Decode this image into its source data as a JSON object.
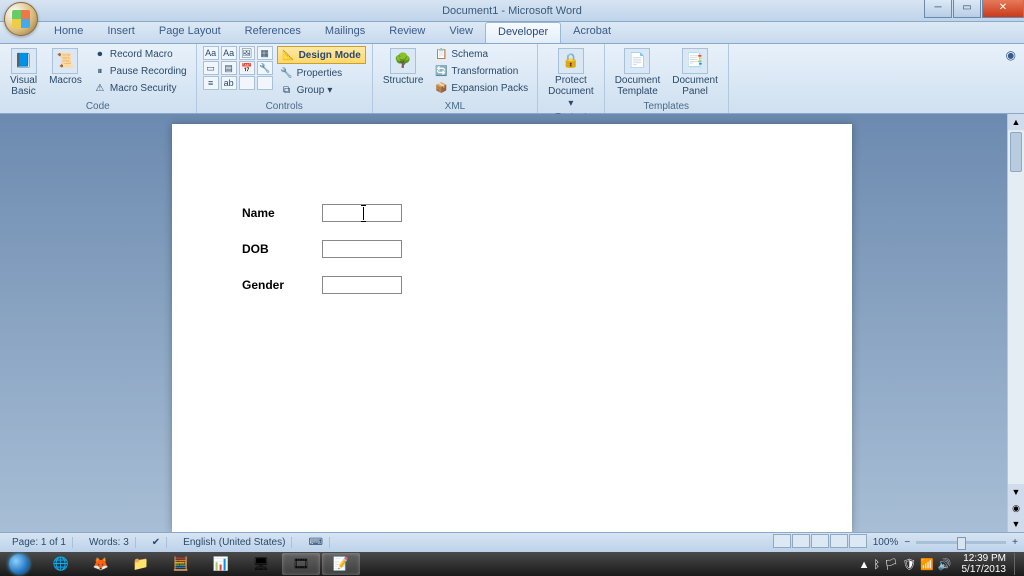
{
  "titlebar": {
    "title": "Document1 - Microsoft Word"
  },
  "tabs": [
    "Home",
    "Insert",
    "Page Layout",
    "References",
    "Mailings",
    "Review",
    "View",
    "Developer",
    "Acrobat"
  ],
  "active_tab": "Developer",
  "ribbon": {
    "code": {
      "label": "Code",
      "visual_basic": "Visual\nBasic",
      "macros": "Macros",
      "record": "Record Macro",
      "pause": "Pause Recording",
      "security": "Macro Security"
    },
    "controls": {
      "label": "Controls",
      "design": "Design Mode",
      "properties": "Properties",
      "group": "Group"
    },
    "xml": {
      "label": "XML",
      "structure": "Structure",
      "schema": "Schema",
      "transformation": "Transformation",
      "expansion": "Expansion Packs"
    },
    "protect": {
      "label": "Protect",
      "protect_doc": "Protect\nDocument"
    },
    "templates": {
      "label": "Templates",
      "doc_template": "Document\nTemplate",
      "doc_panel": "Document\nPanel"
    }
  },
  "form": {
    "name": "Name",
    "dob": "DOB",
    "gender": "Gender"
  },
  "statusbar": {
    "page": "Page: 1 of 1",
    "words": "Words: 3",
    "lang": "English (United States)",
    "zoom": "100%"
  },
  "tray": {
    "time": "12:39 PM",
    "date": "5/17/2013"
  }
}
